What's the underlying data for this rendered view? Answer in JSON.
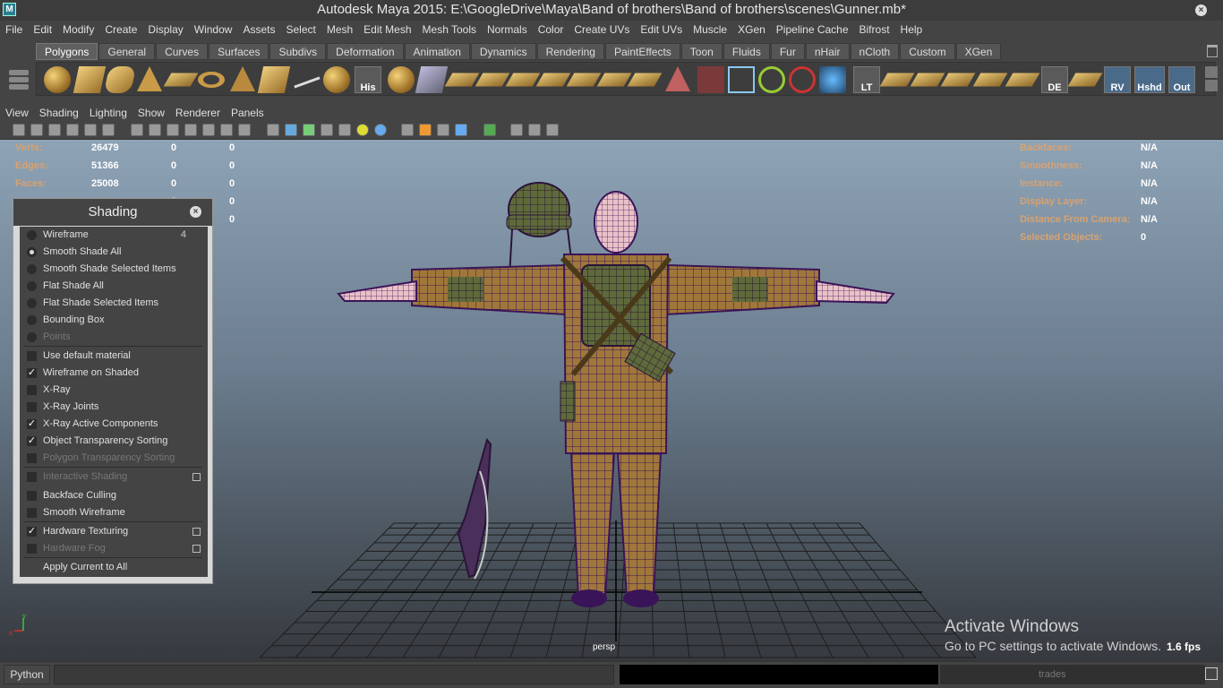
{
  "app": {
    "title": "Autodesk Maya 2015: E:\\GoogleDrive\\Maya\\Band of brothers\\Band of brothers\\scenes\\Gunner.mb*",
    "logo": "M",
    "close": "×"
  },
  "menubar": [
    "File",
    "Edit",
    "Modify",
    "Create",
    "Display",
    "Window",
    "Assets",
    "Select",
    "Mesh",
    "Edit Mesh",
    "Mesh Tools",
    "Normals",
    "Color",
    "Create UVs",
    "Edit UVs",
    "Muscle",
    "XGen",
    "Pipeline Cache",
    "Bifrost",
    "Help"
  ],
  "shelf_tabs": [
    "Polygons",
    "General",
    "Curves",
    "Surfaces",
    "Subdivs",
    "Deformation",
    "Animation",
    "Dynamics",
    "Rendering",
    "PaintEffects",
    "Toon",
    "Fluids",
    "Fur",
    "nHair",
    "nCloth",
    "Custom",
    "XGen"
  ],
  "shelf_text_icons": {
    "his": "His",
    "lt": "LT",
    "de": "DE",
    "rv": "RV",
    "hshd": "Hshd",
    "out": "Out"
  },
  "panel_menu": [
    "View",
    "Shading",
    "Lighting",
    "Show",
    "Renderer",
    "Panels"
  ],
  "hud_left": [
    {
      "label": "Verts:",
      "v1": "26479",
      "v2": "0",
      "v3": "0"
    },
    {
      "label": "Edges:",
      "v1": "51366",
      "v2": "0",
      "v3": "0"
    },
    {
      "label": "Faces:",
      "v1": "25008",
      "v2": "0",
      "v3": "0"
    },
    {
      "label": "",
      "v1": "",
      "v2": "0",
      "v3": "0"
    },
    {
      "label": "",
      "v1": "",
      "v2": "0",
      "v3": "0"
    }
  ],
  "hud_right": [
    {
      "label": "Backfaces:",
      "value": "N/A"
    },
    {
      "label": "Smoothness:",
      "value": "N/A"
    },
    {
      "label": "Instance:",
      "value": "N/A"
    },
    {
      "label": "Display Layer:",
      "value": "N/A"
    },
    {
      "label": "Distance From Camera:",
      "value": "N/A"
    },
    {
      "label": "Selected Objects:",
      "value": "0"
    }
  ],
  "shading_menu": {
    "title": "Shading",
    "items": [
      {
        "label": "Wireframe",
        "type": "radio",
        "checked": false,
        "enabled": true,
        "num": "4"
      },
      {
        "label": "Smooth Shade All",
        "type": "radio",
        "checked": true,
        "enabled": true
      },
      {
        "label": "Smooth Shade Selected Items",
        "type": "radio",
        "checked": false,
        "enabled": true
      },
      {
        "label": "Flat Shade All",
        "type": "radio",
        "checked": false,
        "enabled": true
      },
      {
        "label": "Flat Shade Selected Items",
        "type": "radio",
        "checked": false,
        "enabled": true
      },
      {
        "label": "Bounding Box",
        "type": "radio",
        "checked": false,
        "enabled": true
      },
      {
        "label": "Points",
        "type": "radio",
        "checked": false,
        "enabled": false
      },
      {
        "label": "Use default material",
        "type": "check",
        "checked": false,
        "enabled": true
      },
      {
        "label": "Wireframe on Shaded",
        "type": "check",
        "checked": true,
        "enabled": true
      },
      {
        "label": "X-Ray",
        "type": "check",
        "checked": false,
        "enabled": true
      },
      {
        "label": "X-Ray Joints",
        "type": "check",
        "checked": false,
        "enabled": true
      },
      {
        "label": "X-Ray Active Components",
        "type": "check",
        "checked": true,
        "enabled": true
      },
      {
        "label": "Object Transparency Sorting",
        "type": "check",
        "checked": true,
        "enabled": true
      },
      {
        "label": "Polygon Transparency Sorting",
        "type": "check",
        "checked": false,
        "enabled": false
      },
      {
        "label": "Interactive Shading",
        "type": "check",
        "checked": false,
        "enabled": false,
        "option": true
      },
      {
        "label": "Backface Culling",
        "type": "check",
        "checked": false,
        "enabled": true
      },
      {
        "label": "Smooth Wireframe",
        "type": "check",
        "checked": false,
        "enabled": true
      },
      {
        "label": "Hardware Texturing",
        "type": "check",
        "checked": true,
        "enabled": true,
        "option": true
      },
      {
        "label": "Hardware Fog",
        "type": "check",
        "checked": false,
        "enabled": false,
        "option": true
      },
      {
        "label": "Apply Current to All",
        "type": "none",
        "enabled": true
      }
    ]
  },
  "viewport": {
    "camera": "persp",
    "fps": "1.6 fps",
    "axis_y": "y",
    "axis_x": "x"
  },
  "watermark": {
    "line1": "Activate Windows",
    "line2": "Go to PC settings to activate Windows."
  },
  "cmdline": {
    "lang": "Python",
    "task": "trades"
  }
}
